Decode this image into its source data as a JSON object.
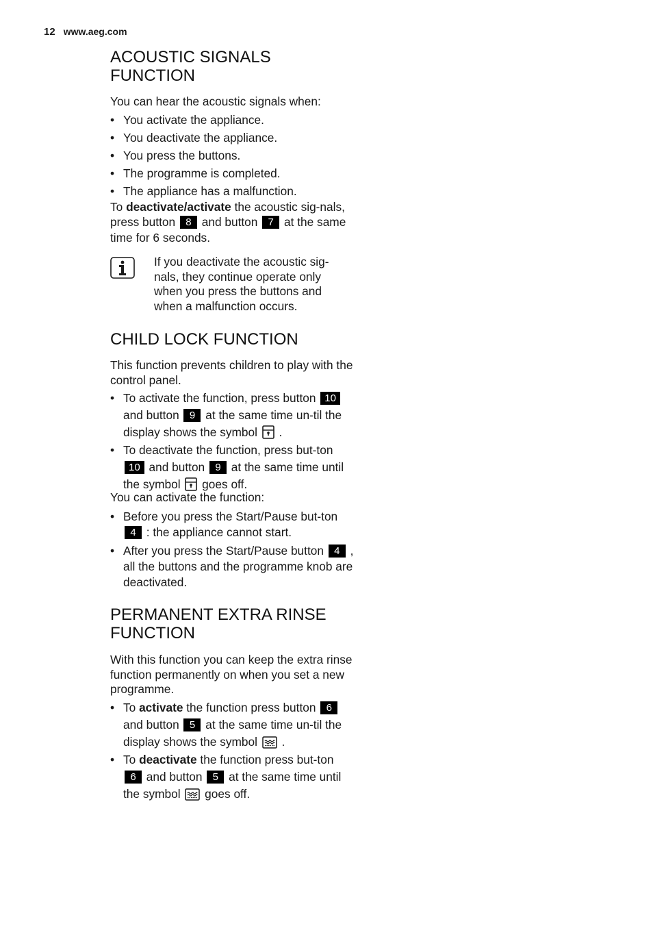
{
  "header": {
    "page_number": "12",
    "website": "www.aeg.com"
  },
  "acoustic": {
    "title": "ACOUSTIC SIGNALS FUNCTION",
    "intro": "You can hear the acoustic signals when:",
    "bullets": [
      "You activate the appliance.",
      "You deactivate the appliance.",
      "You press the buttons.",
      "The programme is completed.",
      "The appliance has a malfunction."
    ],
    "instr_prefix": "To ",
    "instr_bold": "deactivate/activate",
    "instr_mid1": " the acoustic sig-nals, press button ",
    "button_a": "8",
    "instr_mid2": " and button ",
    "button_b": "7",
    "instr_suffix": " at the same time for 6 seconds.",
    "info_icon": "info-icon",
    "info_text": "If you deactivate the acoustic sig-nals, they continue operate only when you press the buttons and when a malfunction occurs."
  },
  "childlock": {
    "title": "CHILD LOCK FUNCTION",
    "intro": "This function prevents children to play with the control panel.",
    "b1_pre": "To activate the function, press button ",
    "b1_btn1": "10",
    "b1_mid": " and button ",
    "b1_btn2": "9",
    "b1_post": " at the same time un-til the display shows the symbol ",
    "b1_end": " .",
    "b2_pre": "To deactivate the function, press but-ton ",
    "b2_btn1": "10",
    "b2_mid": " and button ",
    "b2_btn2": "9",
    "b2_post": " at the same time until the symbol ",
    "b2_end": " goes off.",
    "symbol_icon": "child-lock-icon",
    "intro2": "You can activate the function:",
    "b3_pre": "Before you press the Start/Pause but-ton ",
    "b3_btn": "4",
    "b3_post": " : the appliance cannot start.",
    "b4_pre": "After you press the Start/Pause button ",
    "b4_btn": "4",
    "b4_post": " , all the buttons and the programme knob are deactivated."
  },
  "rinse": {
    "title": "PERMANENT EXTRA RINSE FUNCTION",
    "intro": "With this function you can keep the extra rinse function permanently on when you set a new programme.",
    "b1_pre": "To ",
    "b1_bold": "activate",
    "b1_mid0": " the function press button ",
    "b1_btn1": "6",
    "b1_mid": " and button ",
    "b1_btn2": "5",
    "b1_post": " at the same time un-til the display shows the symbol ",
    "b1_end": " .",
    "b2_pre": "To ",
    "b2_bold": "deactivate",
    "b2_mid0": " the function press but-ton ",
    "b2_btn1": "6",
    "b2_mid": " and button ",
    "b2_btn2": "5",
    "b2_post": " at the same time until the symbol ",
    "b2_end": " goes off.",
    "symbol_icon": "extra-rinse-icon"
  }
}
